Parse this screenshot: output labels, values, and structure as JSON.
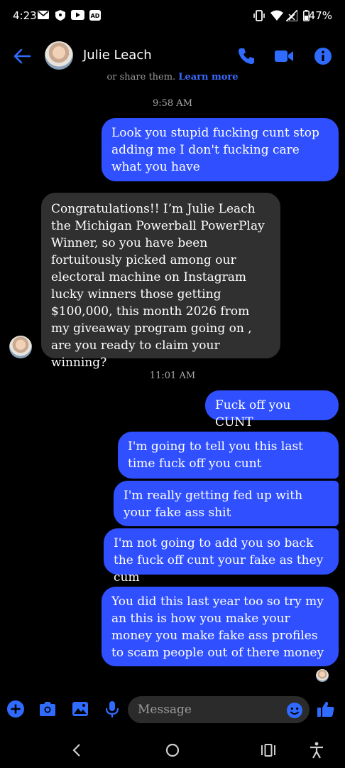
{
  "status_bar": {
    "time": "4:23",
    "battery": "47%"
  },
  "header": {
    "contact_name": "Julie Leach"
  },
  "cutoff_notice": {
    "text": "or share them. ",
    "link": "Learn more"
  },
  "messages": [
    {
      "type": "timestamp",
      "text": "9:58 AM"
    },
    {
      "type": "outgoing",
      "text": "Look you stupid fucking cunt stop adding me I don't fucking care what you have"
    },
    {
      "type": "incoming",
      "text": "Congratulations!! I’m Julie Leach the Michigan Powerball PowerPlay Winner, so you have been fortuitously picked among our electoral machine on Instagram lucky winners those getting $100,000, this month 2026 from my giveaway program going on , are you ready to claim your winning?"
    },
    {
      "type": "timestamp",
      "text": "11:01 AM"
    },
    {
      "type": "outgoing",
      "text": "Fuck off you CUNT"
    },
    {
      "type": "outgoing",
      "text": "I'm going to tell you this last time fuck off you cunt"
    },
    {
      "type": "outgoing",
      "text": "I'm really getting fed up with your fake ass shit"
    },
    {
      "type": "outgoing",
      "text": "I'm not going to add you so back the fuck off cunt your fake as they cum"
    },
    {
      "type": "outgoing",
      "text": "You did this last year too so try my an this is how you make your money you make fake ass profiles to scam people out of there money"
    }
  ],
  "composer": {
    "placeholder": "Message"
  },
  "colors": {
    "accent": "#3050ff",
    "icon_blue": "#2f6bff",
    "incoming_bubble": "#303030",
    "background": "#000000"
  }
}
